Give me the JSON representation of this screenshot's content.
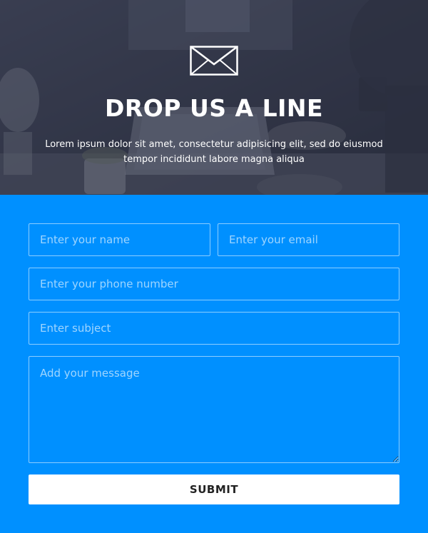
{
  "header": {
    "icon": "envelope-icon",
    "title": "DROP US A LINE",
    "subtitle": "Lorem ipsum dolor sit amet, consectetur adipisicing elit, sed do eiusmod tempor incididunt labore magna aliqua"
  },
  "form": {
    "name_placeholder": "Enter your name",
    "email_placeholder": "Enter your email",
    "phone_placeholder": "Enter your phone number",
    "subject_placeholder": "Enter subject",
    "message_placeholder": "Add your message",
    "submit_label": "SUBMIT"
  },
  "colors": {
    "form_background": "#0090ff",
    "header_overlay": "#2c3042",
    "button_background": "#ffffff",
    "button_text": "#222222"
  }
}
